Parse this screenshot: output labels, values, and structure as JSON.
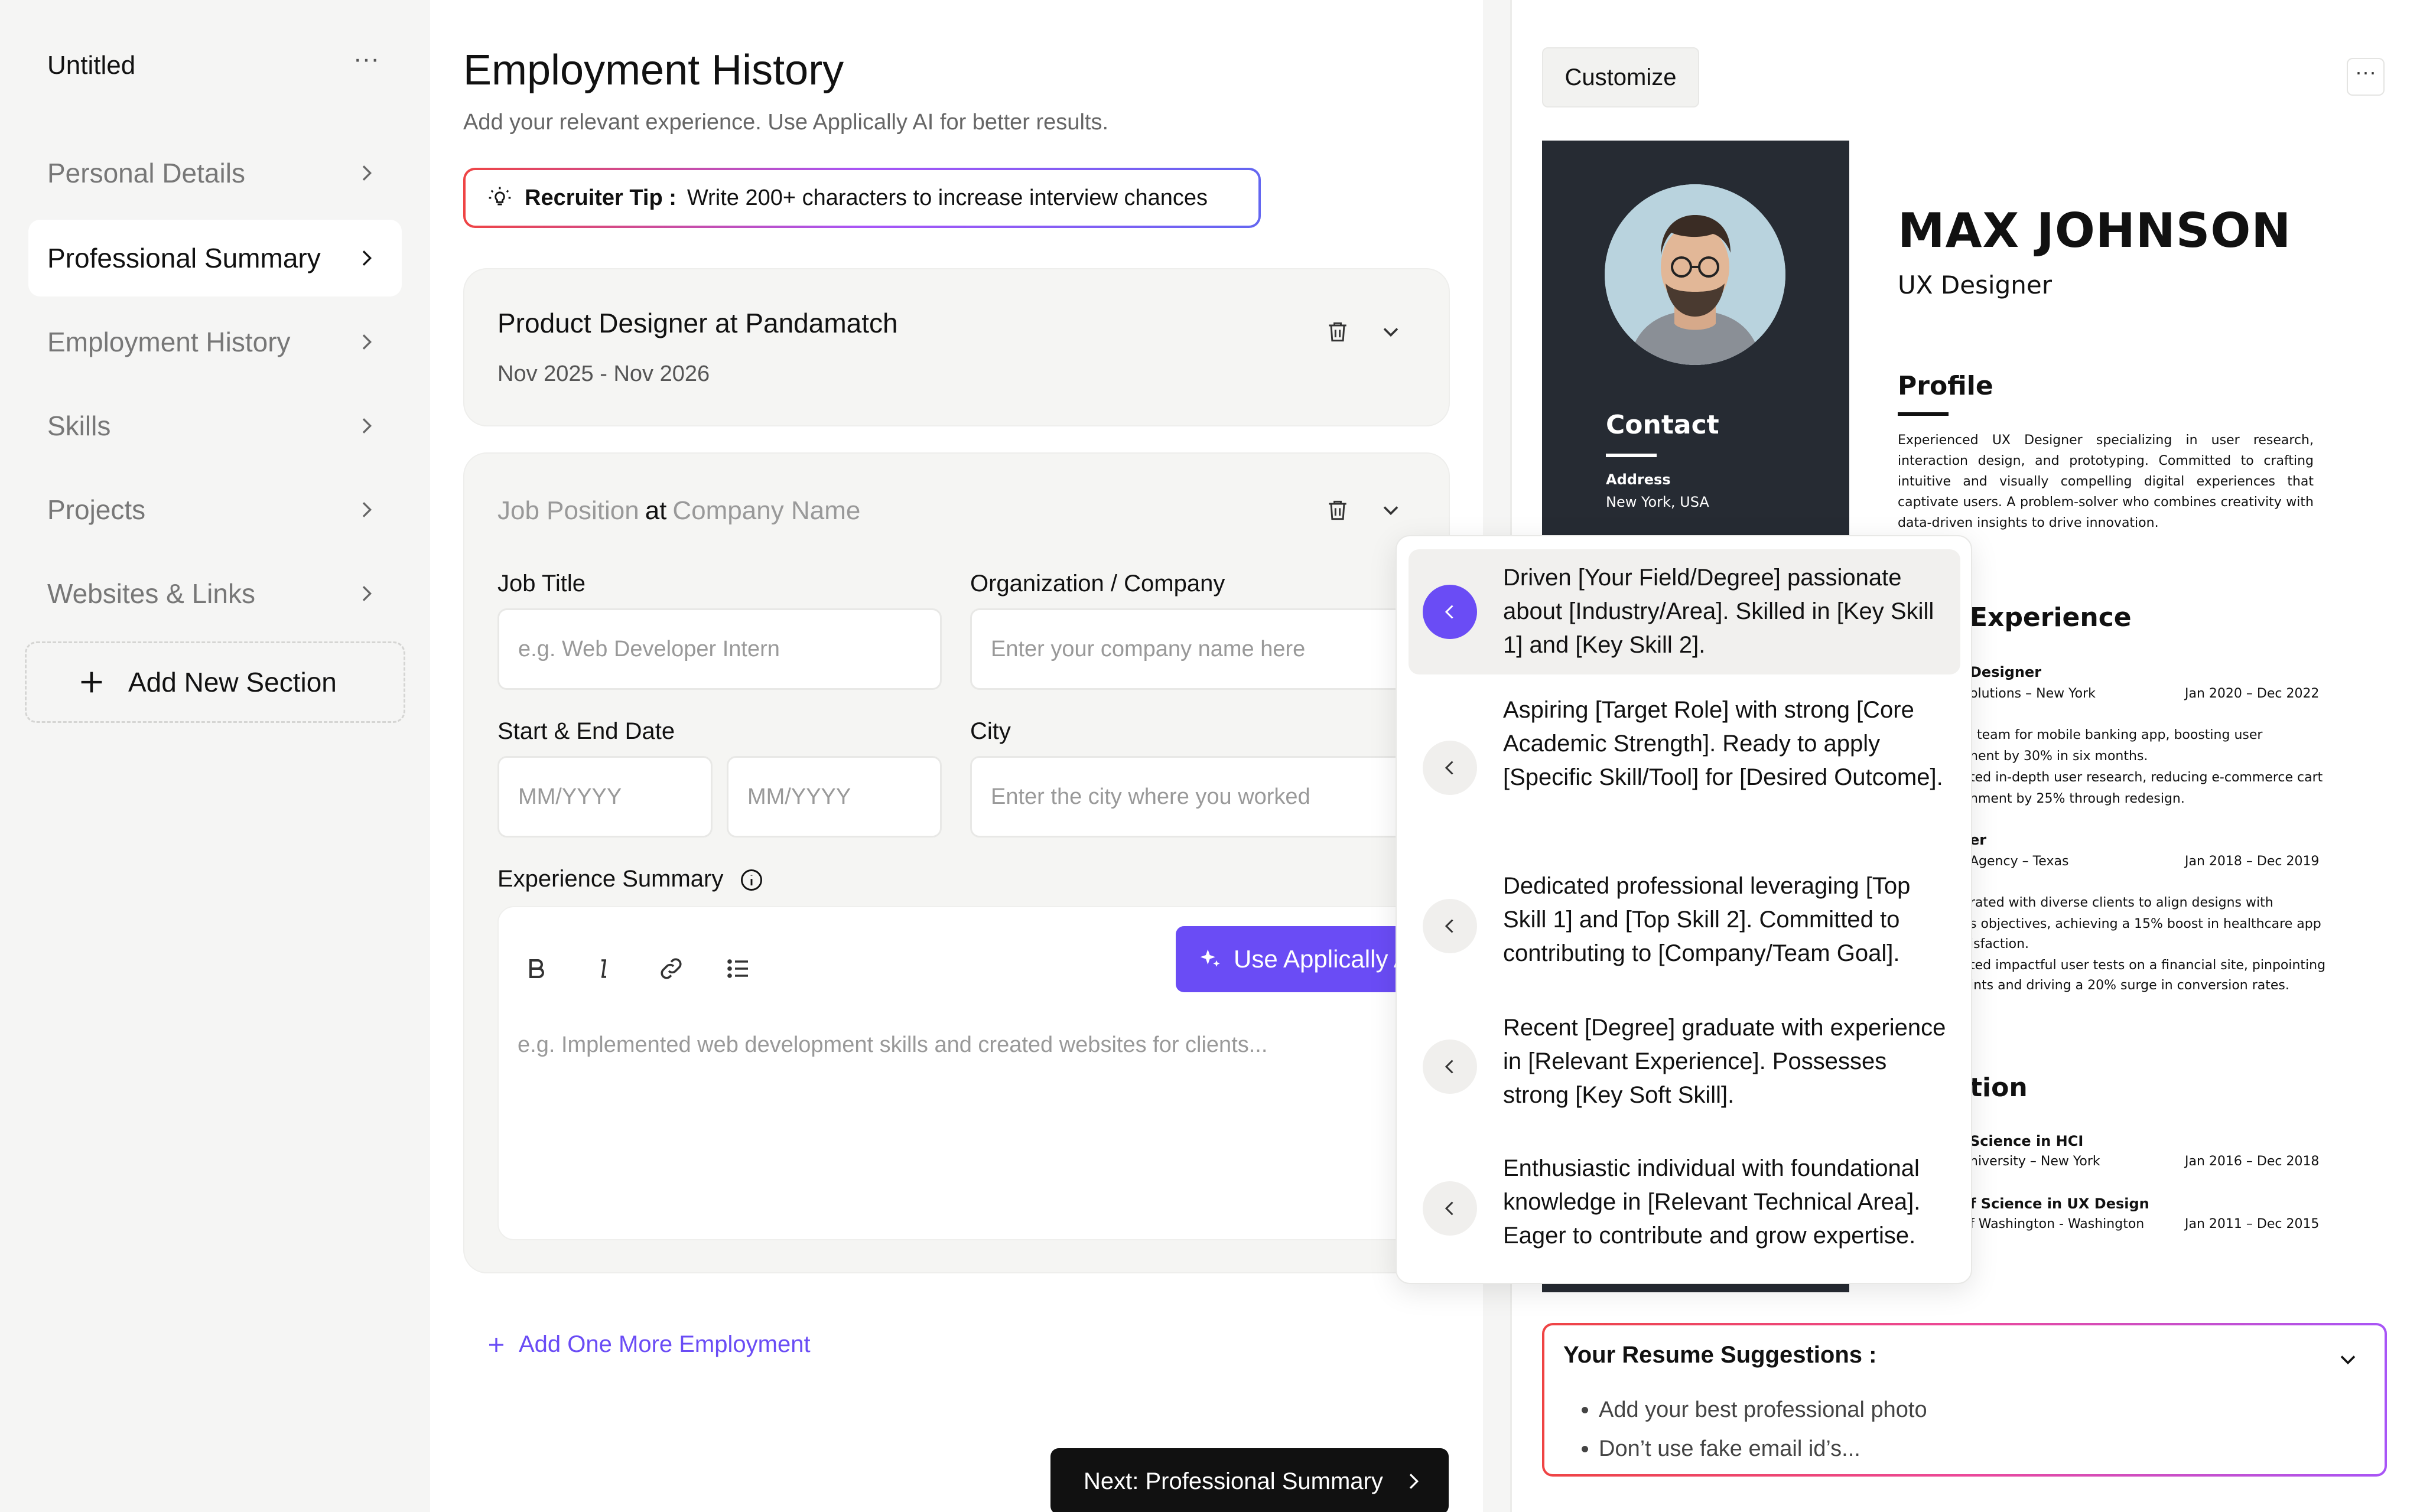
{
  "sidebar": {
    "doc_title": "Untitled",
    "more": "···",
    "items": [
      {
        "label": "Personal Details"
      },
      {
        "label": "Professional Summary"
      },
      {
        "label": "Employment History"
      },
      {
        "label": "Skills"
      },
      {
        "label": "Projects"
      },
      {
        "label": "Websites & Links"
      }
    ],
    "active_index": 1,
    "add_section": "Add New Section"
  },
  "main": {
    "title": "Employment History",
    "subtitle": "Add your relevant experience. Use Applically AI for better results.",
    "tip_label": "Recruiter Tip :",
    "tip_text": "Write 200+ characters to increase interview chances",
    "entry1": {
      "title": "Product Designer at Pandamatch",
      "dates": "Nov 2025 - Nov 2026"
    },
    "entry2": {
      "position_placeholder": "Job Position",
      "at": "at",
      "company_placeholder": "Company Name",
      "job_title_label": "Job Title",
      "job_title_placeholder": "e.g. Web Developer Intern",
      "company_label": "Organization / Company",
      "company_input_placeholder": "Enter your company name here",
      "dates_label": "Start & End Date",
      "start_placeholder": "MM/YYYY",
      "end_placeholder": "MM/YYYY",
      "city_label": "City",
      "city_placeholder": "Enter the city where you worked",
      "summary_label": "Experience Summary",
      "ai_button": "Use Applically AI",
      "summary_placeholder": "e.g. Implemented web development skills and created websites for clients..."
    },
    "add_more": "Add One More Employment",
    "next_button": "Next: Professional Summary"
  },
  "ai_suggestions": [
    "Driven [Your Field/Degree] passionate about [Industry/Area]. Skilled in [Key Skill 1] and [Key Skill 2].",
    "Aspiring [Target Role] with strong [Core Academic Strength]. Ready to apply [Specific Skill/Tool] for [Desired Outcome].",
    "Dedicated professional leveraging [Top Skill 1] and [Top Skill 2]. Committed to contributing to [Company/Team Goal].",
    "Recent [Degree] graduate with experience in [Relevant Experience]. Possesses strong [Key Soft Skill].",
    "Enthusiastic individual with foundational knowledge in [Relevant Technical Area]. Eager to contribute and grow expertise."
  ],
  "preview": {
    "customize": "Customize",
    "more": "···",
    "resume": {
      "name": "MAX JOHNSON",
      "role": "UX Designer",
      "contact_heading": "Contact",
      "address_label": "Address",
      "address_value": "New York, USA",
      "profile_heading": "Profile",
      "profile_text": "Experienced UX Designer specializing in user research, interaction design, and prototyping. Committed to crafting intuitive and visually compelling digital experiences that captivate users. A problem-solver who combines creativity with data-driven insights to drive innovation.",
      "experience_heading": "Experience",
      "job1_title": "Designer",
      "job1_org": "olutions – New York",
      "job1_dates": "Jan 2020 – Dec 2022",
      "job1_line1": "team for mobile banking app, boosting user",
      "job1_line2": "nent by 30% in six months.",
      "job1_line3": "ted in-depth user research, reducing e-commerce cart",
      "job1_line4": "nment by 25% through redesign.",
      "job2_title": "er",
      "job2_org": "Agency – Texas",
      "job2_dates": "Jan 2018 – Dec 2019",
      "job2_line1": "rated with diverse clients to align designs with",
      "job2_line2": "s objectives, achieving a 15% boost in healthcare app",
      "job2_line3": "isfaction.",
      "job2_line4": "ted impactful user tests on a financial site, pinpointing",
      "job2_line5": "ints and driving a 20% surge in conversion rates.",
      "education_heading": "tion",
      "edu1_title": "Science in HCI",
      "edu1_org": "niversity – New York",
      "edu1_dates": "Jan 2016 – Dec 2018",
      "edu2_title": "f Science in UX Design",
      "edu2_org": "f Washington - Washington",
      "edu2_dates": "Jan 2011 – Dec 2015"
    },
    "suggestions_title": "Your Resume Suggestions :",
    "suggestions": [
      "Add your best professional photo",
      "Don’t use fake email id’s..."
    ]
  },
  "colors": {
    "accent": "#6a4cf5",
    "dark": "#111111",
    "resume_sidebar": "#262b33",
    "tip_border_start": "#ef4444",
    "tip_border_end": "#6366f1"
  }
}
